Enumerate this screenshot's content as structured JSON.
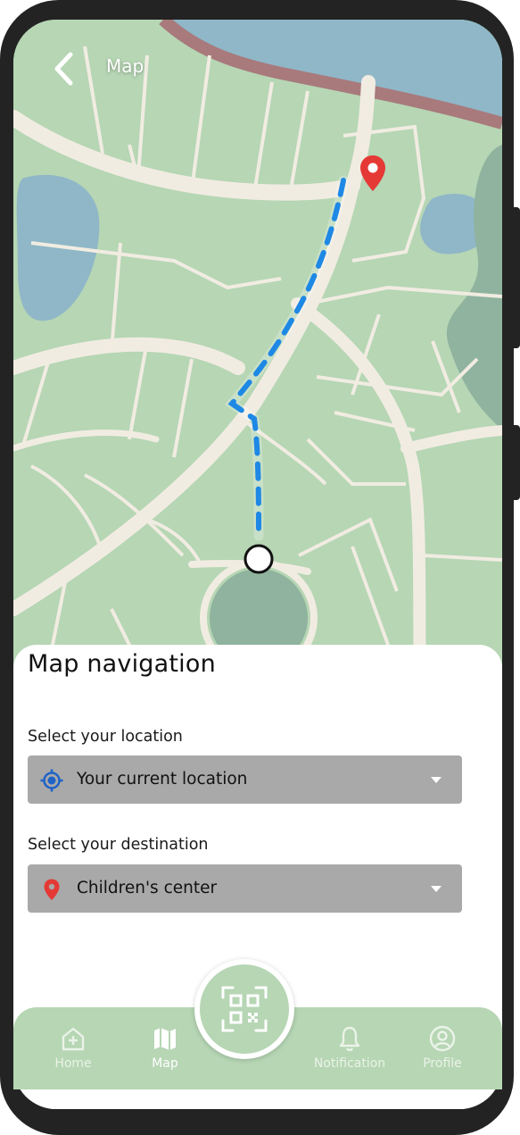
{
  "header": {
    "title": "Map",
    "back_icon": "chevron-left-icon"
  },
  "map": {
    "origin_marker": "current-location-dot",
    "destination_marker": "map-pin-icon",
    "colors": {
      "land": "#b6d6b4",
      "road": "#f1ece2",
      "water": "#8fb7c8",
      "park": "#8fb39e",
      "route": "#1e88e5",
      "pin": "#e53935"
    }
  },
  "sheet": {
    "title": "Map navigation",
    "location": {
      "label": "Select your location",
      "value": "Your current location",
      "icon": "crosshair-location-icon"
    },
    "destination": {
      "label": "Select your destination",
      "value": "Children's center",
      "icon": "map-pin-icon"
    }
  },
  "nav": {
    "items": [
      {
        "label": "Home",
        "icon": "home-plus-icon",
        "active": false
      },
      {
        "label": "Map",
        "icon": "map-icon",
        "active": true
      },
      {
        "label": "Notification",
        "icon": "bell-icon",
        "active": false
      },
      {
        "label": "Profile",
        "icon": "user-circle-icon",
        "active": false
      }
    ],
    "scan_icon": "qr-code-icon"
  }
}
